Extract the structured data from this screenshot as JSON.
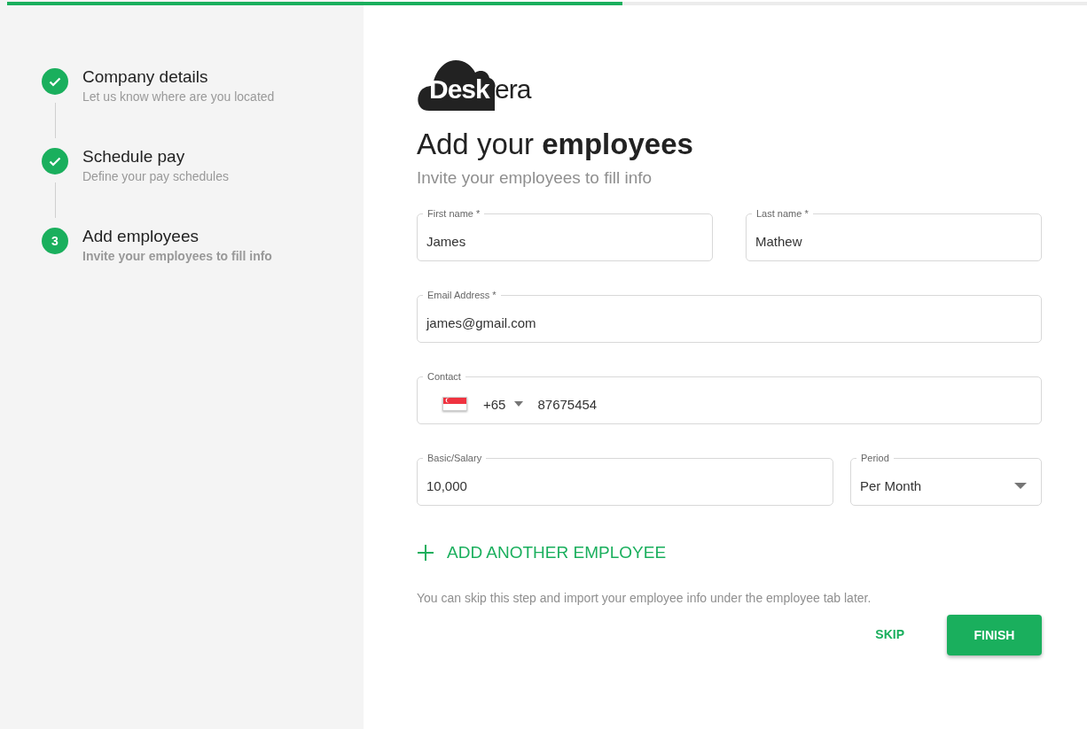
{
  "progress": {
    "level": 0.57
  },
  "steps": [
    {
      "title": "Company details",
      "subtitle": "Let us know where are you located",
      "completed": true,
      "selected": false
    },
    {
      "title": "Schedule pay",
      "subtitle": "Define your pay schedules",
      "completed": true,
      "selected": false
    },
    {
      "title": "Add employees",
      "subtitle": "Invite your employees to fill info",
      "number": "3",
      "completed": false,
      "selected": true
    }
  ],
  "logo": {
    "part_1": "Desk",
    "part_2": "era"
  },
  "heading": "Add your **employees**",
  "subheading": "Invite your employees to fill info",
  "form": {
    "first_name": {
      "label": "First name *",
      "value": "James"
    },
    "last_name": {
      "label": "Last name *",
      "value": "Mathew"
    },
    "email": {
      "label": "Email Address *",
      "value": "james@gmail.com"
    },
    "contact": {
      "label": "Contact",
      "dial_code": "+65",
      "value": "87675454"
    },
    "salary": {
      "label": "Basic/Salary",
      "value": "10,000"
    },
    "period": {
      "label": "Period",
      "value": "Per Month"
    }
  },
  "add_another": "ADD ANOTHER EMPLOYEE",
  "note": "You can skip this step and import your employee info under the employee tab later.",
  "buttons": {
    "skip": "SKIP",
    "finish": "FINISH"
  }
}
